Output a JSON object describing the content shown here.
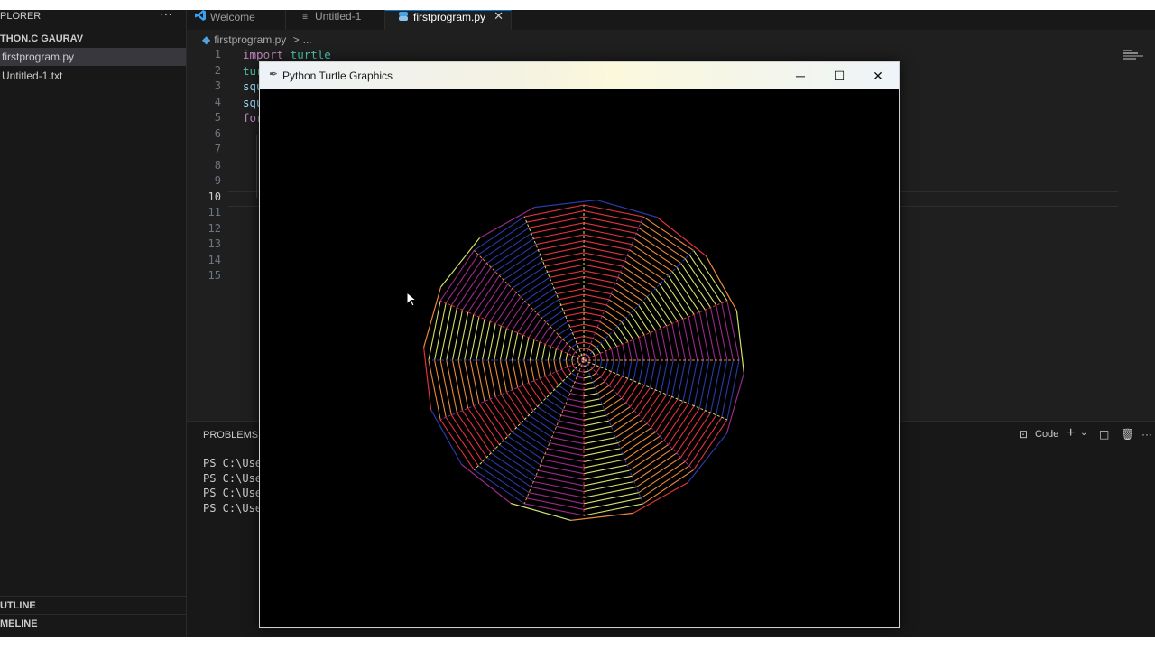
{
  "sidebar": {
    "title": "PLORER",
    "more_icon": "ellipsis-icon",
    "folder": "THON.C GAURAV",
    "files": [
      "firstprogram.py",
      "Untitled-1.txt"
    ],
    "outline": "UTLINE",
    "timeline": "MELINE"
  },
  "tabs": [
    {
      "label": "Welcome",
      "icon": "vscode-icon"
    },
    {
      "label": "Untitled-1",
      "icon": "text-file-icon"
    },
    {
      "label": "firstprogram.py",
      "icon": "python-file-icon"
    }
  ],
  "breadcrumb": {
    "file": "firstprogram.py",
    "sep": ">",
    "rest": "..."
  },
  "editor": {
    "line_numbers": [
      "1",
      "2",
      "3",
      "4",
      "5",
      "6",
      "7",
      "8",
      "9",
      "10",
      "11",
      "12",
      "13",
      "14",
      "15"
    ],
    "current_line": "10",
    "lines": [
      {
        "kw": "import",
        "rest": " turtle"
      },
      {
        "kw": "",
        "rest": "tur"
      },
      {
        "kw": "",
        "rest": "squ"
      },
      {
        "kw": "",
        "rest": "squ"
      },
      {
        "kw": "for",
        "rest": ""
      }
    ]
  },
  "panel": {
    "title": "PROBLEMS",
    "terminal_lines": [
      "PS C:\\User",
      "PS C:\\User",
      "PS C:\\User",
      "PS C:\\User"
    ],
    "terminal_name": "Code"
  },
  "turtle_window": {
    "title": "Python Turtle Graphics",
    "minimize_icon": "minimize-icon",
    "maximize_icon": "maximize-icon",
    "close_icon": "close-icon",
    "background": "#000000"
  },
  "colors": {
    "accent": "#0078d4",
    "turtle_palette": [
      "#e0333c",
      "#eb8a3a",
      "#d4e06a",
      "#9a2a8a",
      "#2a3aa8"
    ]
  }
}
